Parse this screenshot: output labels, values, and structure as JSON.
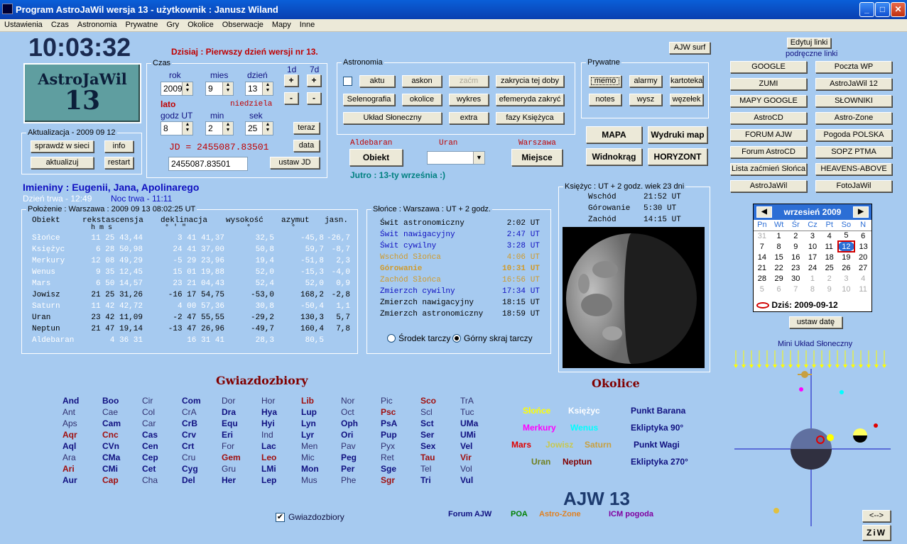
{
  "window": {
    "title": "Program AstroJaWil wersja 13 - użytkownik : Janusz Wiland",
    "min": "_",
    "max": "□",
    "close": "✕"
  },
  "menu": [
    "Ustawienia",
    "Czas",
    "Astronomia",
    "Prywatne",
    "Gry",
    "Okolice",
    "Obserwacje",
    "Mapy",
    "Inne"
  ],
  "clock": "10:03:32",
  "logo": {
    "line1": "AstroJaWil",
    "line2": "13"
  },
  "today_msg": "Dzisiaj : Pierwszy dzień wersji nr 13.",
  "czas": {
    "legend": "Czas",
    "rok_label": "rok",
    "mies_label": "mies",
    "dzien_label": "dzień",
    "d1_label": "1d",
    "d7_label": "7d",
    "rok": "2009",
    "mies": "9",
    "dzien": "13",
    "season": "lato",
    "weekday": "niedziela",
    "godz_label": "godz UT",
    "min_label": "min",
    "sek_label": "sek",
    "godz": "8",
    "min": "2",
    "sek": "25",
    "teraz": "teraz",
    "data": "data",
    "jd_text": "JD = 2455087.83501",
    "jd_input": "2455087.83501",
    "ustaw_jd": "ustaw JD",
    "plus": "+",
    "minus": "-"
  },
  "aktualizacja": {
    "legend": "Aktualizacja - 2009 09 12",
    "sprawdz": "sprawdź w sieci",
    "info": "info",
    "aktualizuj": "aktualizuj",
    "restart": "restart"
  },
  "astronomia": {
    "legend": "Astronomia",
    "aktu": "aktu",
    "askon": "askon",
    "zacm": "zaćm",
    "zakrycia": "zakrycia tej doby",
    "selenografia": "Selenografia",
    "okolice": "okolice",
    "wykres": "wykres",
    "efemeryda": "efemeryda zakryć",
    "uklad": "Układ Słoneczny",
    "extra": "extra",
    "fazy": "fazy Księżyca"
  },
  "prywatne": {
    "legend": "Prywatne",
    "memo": "memo",
    "alarmy": "alarmy",
    "kartoteka": "kartoteka",
    "notes": "notes",
    "wysz": "wysz",
    "wezelek": "węzełek"
  },
  "ajw_surf": "AJW surf",
  "obiekt": {
    "label": "Aldebaran",
    "btn": "Obiekt",
    "uran": "Uran",
    "warszawa": "Warszawa",
    "miejsce": "Miejsce"
  },
  "jutro": "Jutro :   13-ty września :)",
  "maps": {
    "mapa": "MAPA",
    "wydruki": "Wydruki map",
    "widnokrag": "Widnokrąg",
    "horyzont": "HORYZONT"
  },
  "links": {
    "edit": "Edytuj linki",
    "caption": "podręczne linki",
    "items": [
      "GOOGLE",
      "Poczta WP",
      "ZUMI",
      "AstroJaWil 12",
      "MAPY GOOGLE",
      "SŁOWNIKI",
      "AstroCD",
      "Astro-Zone",
      "FORUM AJW",
      "Pogoda POLSKA",
      "Forum AstroCD",
      "SOPZ PTMA",
      "Lista zaćmień Słońca",
      "HEAVENS-ABOVE",
      "AstroJaWil",
      "FotoJaWil"
    ]
  },
  "imieniny": "Imieniny : Eugenii, Jana, Apolinarego",
  "dzien": "Dzień trwa - 12:49",
  "noc": "Noc trwa - 11:11",
  "polozenie": {
    "legend": "Położenie : Warszawa : 2009 09 13   08:02:25 UT",
    "headers": [
      "Obiekt",
      "rekstascensja",
      "deklinacja",
      "wysokość",
      "azymut",
      "jasn."
    ],
    "sub_ra": "h  m  s",
    "sub_dec": "°  '  \"",
    "sub_alt": "°",
    "sub_az": "°",
    "rows": [
      {
        "name": "Słońce",
        "ra": "11 25 43,44",
        "dec": "3 41 41,37",
        "alt": "32,5",
        "az": "-45,8",
        "mag": "-26,7",
        "color": "#ffffff"
      },
      {
        "name": "Księżyc",
        "ra": "6 28 50,98",
        "dec": "24 41 37,00",
        "alt": "50,8",
        "az": "59,7",
        "mag": "-8,7",
        "color": "#ffffff"
      },
      {
        "name": "Merkury",
        "ra": "12 08 49,29",
        "dec": "-5 29 23,96",
        "alt": "19,4",
        "az": "-51,8",
        "mag": "2,3",
        "color": "#ffffff"
      },
      {
        "name": "Wenus",
        "ra": "9 35 12,45",
        "dec": "15 01 19,88",
        "alt": "52,0",
        "az": "-15,3",
        "mag": "-4,0",
        "color": "#ffffff"
      },
      {
        "name": "Mars",
        "ra": "6 50 14,57",
        "dec": "23 21 04,43",
        "alt": "52,4",
        "az": "52,0",
        "mag": "0,9",
        "color": "#ffffff"
      },
      {
        "name": "Jowisz",
        "ra": "21 25 31,26",
        "dec": "-16 17 54,75",
        "alt": "-53,0",
        "az": "168,2",
        "mag": "-2,8",
        "color": "#000000"
      },
      {
        "name": "Saturn",
        "ra": "11 42 42,72",
        "dec": "4 00 57,36",
        "alt": "30,8",
        "az": "-50,4",
        "mag": "1,1",
        "color": "#ffffff"
      },
      {
        "name": "Uran",
        "ra": "23 42 11,09",
        "dec": "-2 47 55,55",
        "alt": "-29,2",
        "az": "130,3",
        "mag": "5,7",
        "color": "#000000"
      },
      {
        "name": "Neptun",
        "ra": "21 47 19,14",
        "dec": "-13 47 26,96",
        "alt": "-49,7",
        "az": "160,4",
        "mag": "7,8",
        "color": "#000000"
      },
      {
        "name": "Aldebaran",
        "ra": "4 36 31",
        "dec": "16 31 41",
        "alt": "28,3",
        "az": "80,5",
        "mag": "",
        "color": "#ffffff"
      }
    ]
  },
  "slonce": {
    "legend": "Słońce : Warszawa : UT + 2 godz.",
    "rows": [
      {
        "name": "Świt astronomiczny",
        "time": "2:02",
        "ut": "UT",
        "color": "#000000"
      },
      {
        "name": "Świt nawigacyjny",
        "time": "2:47",
        "ut": "UT",
        "color": "#1010c0"
      },
      {
        "name": "Świt cywilny",
        "time": "3:28",
        "ut": "UT",
        "color": "#1010c0"
      },
      {
        "name": "Wschód Słońca",
        "time": "4:06",
        "ut": "UT",
        "color": "#d09a2a"
      },
      {
        "name": "Górowanie",
        "time": "10:31",
        "ut": "UT",
        "color": "#d09a2a"
      },
      {
        "name": "Zachód Słońca",
        "time": "16:56",
        "ut": "UT",
        "color": "#d09a2a"
      },
      {
        "name": "Zmierzch cywilny",
        "time": "17:34",
        "ut": "UT",
        "color": "#1010c0"
      },
      {
        "name": "Zmierzch nawigacyjny",
        "time": "18:15",
        "ut": "UT",
        "color": "#000000"
      },
      {
        "name": "Zmierzch astronomiczny",
        "time": "18:59",
        "ut": "UT",
        "color": "#000000"
      }
    ],
    "radio1": "Środek tarczy",
    "radio2": "Górny skraj tarczy"
  },
  "ksiezyc": {
    "legend": "Księżyc : UT + 2 godz.   wiek 23 dni",
    "rows": [
      {
        "name": "Wschód",
        "time": "21:52 UT"
      },
      {
        "name": "Górowanie",
        "time": "5:30 UT"
      },
      {
        "name": "Zachód",
        "time": "14:15 UT"
      }
    ]
  },
  "calendar": {
    "month": "wrzesień 2009",
    "days": [
      "Pn",
      "Wt",
      "Śr",
      "Cz",
      "Pt",
      "So",
      "N"
    ],
    "weeks": [
      [
        "31",
        "1",
        "2",
        "3",
        "4",
        "5",
        "6"
      ],
      [
        "7",
        "8",
        "9",
        "10",
        "11",
        "12",
        "13"
      ],
      [
        "14",
        "15",
        "16",
        "17",
        "18",
        "19",
        "20"
      ],
      [
        "21",
        "22",
        "23",
        "24",
        "25",
        "26",
        "27"
      ],
      [
        "28",
        "29",
        "30",
        "1",
        "2",
        "3",
        "4"
      ],
      [
        "5",
        "6",
        "7",
        "8",
        "9",
        "10",
        "11"
      ]
    ],
    "today": "Dziś: 2009-09-12",
    "set_date": "ustaw datę",
    "prev": "◀",
    "next": "▶"
  },
  "mini_uklad": "Mini Układ Słoneczny",
  "gwiazdozbiory": {
    "title": "Gwiazdozbiory",
    "checkbox": "Gwiazdozbiory",
    "columns": [
      [
        [
          "And",
          "#101080"
        ],
        [
          "Ant",
          "#303070"
        ],
        [
          "Aps",
          "#303070"
        ],
        [
          "Aqr",
          "#a01010"
        ],
        [
          "Aql",
          "#101080"
        ],
        [
          "Ara",
          "#303070"
        ],
        [
          "Ari",
          "#a01010"
        ],
        [
          "Aur",
          "#101080"
        ]
      ],
      [
        [
          "Boo",
          "#101080"
        ],
        [
          "Cae",
          "#303070"
        ],
        [
          "Cam",
          "#101080"
        ],
        [
          "Cnc",
          "#a01010"
        ],
        [
          "CVn",
          "#101080"
        ],
        [
          "CMa",
          "#101080"
        ],
        [
          "CMi",
          "#101080"
        ],
        [
          "Cap",
          "#a01010"
        ]
      ],
      [
        [
          "Cir",
          "#303070"
        ],
        [
          "Col",
          "#303070"
        ],
        [
          "Car",
          "#303070"
        ],
        [
          "Cas",
          "#101080"
        ],
        [
          "Cen",
          "#101080"
        ],
        [
          "Cep",
          "#101080"
        ],
        [
          "Cet",
          "#101080"
        ],
        [
          "Cha",
          "#303070"
        ]
      ],
      [
        [
          "Com",
          "#101080"
        ],
        [
          "CrA",
          "#303070"
        ],
        [
          "CrB",
          "#101080"
        ],
        [
          "Crv",
          "#101080"
        ],
        [
          "Crt",
          "#101080"
        ],
        [
          "Cru",
          "#303070"
        ],
        [
          "Cyg",
          "#101080"
        ],
        [
          "Del",
          "#101080"
        ]
      ],
      [
        [
          "Dor",
          "#303070"
        ],
        [
          "Dra",
          "#101080"
        ],
        [
          "Equ",
          "#101080"
        ],
        [
          "Eri",
          "#101080"
        ],
        [
          "For",
          "#303070"
        ],
        [
          "Gem",
          "#a01010"
        ],
        [
          "Gru",
          "#303070"
        ],
        [
          "Her",
          "#101080"
        ]
      ],
      [
        [
          "Hor",
          "#303070"
        ],
        [
          "Hya",
          "#101080"
        ],
        [
          "Hyi",
          "#101080"
        ],
        [
          "Ind",
          "#303070"
        ],
        [
          "Lac",
          "#101080"
        ],
        [
          "Leo",
          "#a01010"
        ],
        [
          "LMi",
          "#101080"
        ],
        [
          "Lep",
          "#101080"
        ]
      ],
      [
        [
          "Lib",
          "#a01010"
        ],
        [
          "Lup",
          "#101080"
        ],
        [
          "Lyn",
          "#101080"
        ],
        [
          "Lyr",
          "#101080"
        ],
        [
          "Men",
          "#303070"
        ],
        [
          "Mic",
          "#303070"
        ],
        [
          "Mon",
          "#101080"
        ],
        [
          "Mus",
          "#303070"
        ]
      ],
      [
        [
          "Nor",
          "#303070"
        ],
        [
          "Oct",
          "#303070"
        ],
        [
          "Oph",
          "#101080"
        ],
        [
          "Ori",
          "#101080"
        ],
        [
          "Pav",
          "#303070"
        ],
        [
          "Peg",
          "#101080"
        ],
        [
          "Per",
          "#101080"
        ],
        [
          "Phe",
          "#303070"
        ]
      ],
      [
        [
          "Pic",
          "#303070"
        ],
        [
          "Psc",
          "#a01010"
        ],
        [
          "PsA",
          "#101080"
        ],
        [
          "Pup",
          "#101080"
        ],
        [
          "Pyx",
          "#303070"
        ],
        [
          "Ret",
          "#303070"
        ],
        [
          "Sge",
          "#101080"
        ],
        [
          "Sgr",
          "#a01010"
        ]
      ],
      [
        [
          "Sco",
          "#a01010"
        ],
        [
          "Scl",
          "#303070"
        ],
        [
          "Sct",
          "#101080"
        ],
        [
          "Ser",
          "#101080"
        ],
        [
          "Sex",
          "#101080"
        ],
        [
          "Tau",
          "#a01010"
        ],
        [
          "Tel",
          "#303070"
        ],
        [
          "Tri",
          "#101080"
        ]
      ],
      [
        [
          "TrA",
          "#303070"
        ],
        [
          "Tuc",
          "#303070"
        ],
        [
          "UMa",
          "#101080"
        ],
        [
          "UMi",
          "#101080"
        ],
        [
          "Vel",
          "#101080"
        ],
        [
          "Vir",
          "#a01010"
        ],
        [
          "Vol",
          "#303070"
        ],
        [
          "Vul",
          "#101080"
        ]
      ]
    ]
  },
  "okolice": {
    "title": "Okolice",
    "items": [
      {
        "t": "Słońce",
        "c": "#ffff00"
      },
      {
        "t": "Księżyc",
        "c": "#ffffff"
      },
      {
        "t": "Punkt Barana",
        "c": "#101080"
      },
      {
        "t": "Merkury",
        "c": "#ff00ff"
      },
      {
        "t": "Wenus",
        "c": "#00ffff"
      },
      {
        "t": "Ekliptyka 90°",
        "c": "#101080"
      },
      {
        "t": "Mars",
        "c": "#e00000"
      },
      {
        "t": "Jowisz",
        "c": "#c8c850"
      },
      {
        "t": "Saturn",
        "c": "#c8a040"
      },
      {
        "t": "Punkt Wagi",
        "c": "#101080"
      },
      {
        "t": "Uran",
        "c": "#708020"
      },
      {
        "t": "Neptun",
        "c": "#800000"
      },
      {
        "t": "Ekliptyka 270°",
        "c": "#101080"
      }
    ]
  },
  "ajw13": "AJW 13",
  "footer_links": [
    {
      "t": "Forum AJW",
      "c": "#101080"
    },
    {
      "t": "POA",
      "c": "#008000"
    },
    {
      "t": "Astro-Zone",
      "c": "#e08020"
    },
    {
      "t": "ICM pogoda",
      "c": "#8000a0"
    }
  ],
  "arrow_btn": "<-->",
  "ziw_btn": "ZiW"
}
